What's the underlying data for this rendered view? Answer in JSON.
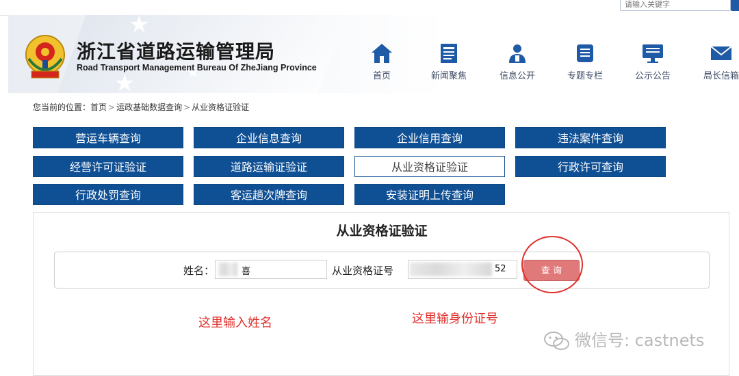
{
  "topbar": {
    "search_placeholder": "请输入关键字"
  },
  "header": {
    "title": "浙江省道路运输管理局",
    "subtitle": "Road Transport Management Bureau Of ZheJiang Province",
    "nav": [
      {
        "label": "首页",
        "icon": "home-icon"
      },
      {
        "label": "新闻聚焦",
        "icon": "news-icon"
      },
      {
        "label": "信息公开",
        "icon": "person-icon"
      },
      {
        "label": "专题专栏",
        "icon": "column-icon"
      },
      {
        "label": "公示公告",
        "icon": "notice-icon"
      },
      {
        "label": "局长信箱",
        "icon": "mail-icon"
      }
    ],
    "nav_color": "#1f5aa6"
  },
  "breadcrumb": {
    "prefix": "您当前的位置：",
    "items": [
      "首页",
      "运政基础数据查询",
      "从业资格证验证"
    ],
    "separator": ">"
  },
  "menu": [
    {
      "label": "营运车辆查询",
      "active": false
    },
    {
      "label": "企业信息查询",
      "active": false
    },
    {
      "label": "企业信用查询",
      "active": false
    },
    {
      "label": "违法案件查询",
      "active": false
    },
    {
      "label": "经营许可证验证",
      "active": false
    },
    {
      "label": "道路运输证验证",
      "active": false
    },
    {
      "label": "从业资格证验证",
      "active": true
    },
    {
      "label": "行政许可查询",
      "active": false
    },
    {
      "label": "行政处罚查询",
      "active": false
    },
    {
      "label": "客运趟次牌查询",
      "active": false
    },
    {
      "label": "安装证明上传查询",
      "active": false
    }
  ],
  "menu_color": "#0f4f94",
  "panel": {
    "title": "从业资格证验证",
    "name_label": "姓名：",
    "name_value": "喜",
    "cert_label": "从业资格证号",
    "cert_value": "52",
    "query_label": "查 询"
  },
  "annotations": {
    "name_hint": "这里输入姓名",
    "id_hint": "这里输身份证号",
    "color": "#e0302c"
  },
  "watermark": "微信号: castnets"
}
